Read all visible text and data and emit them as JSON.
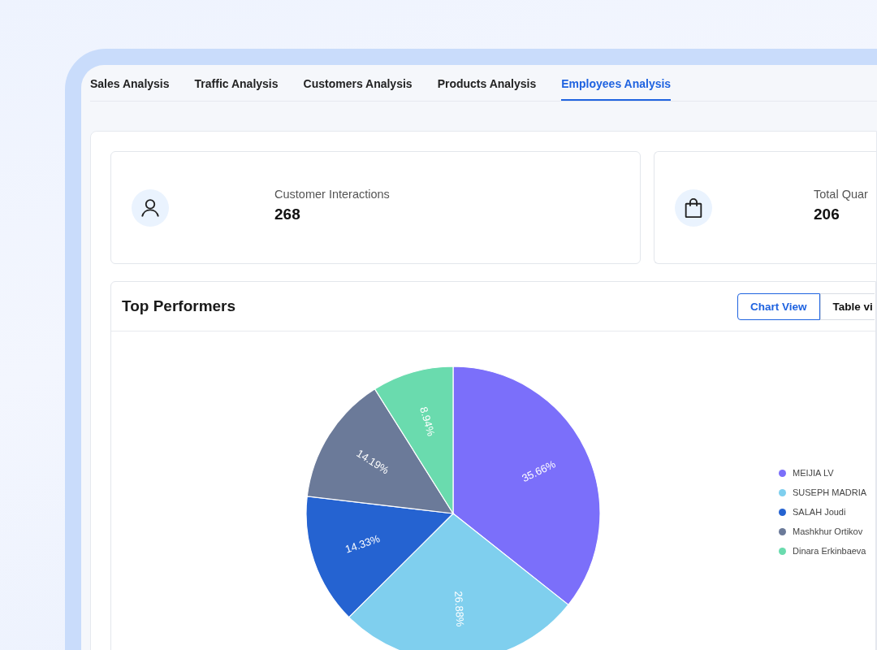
{
  "tabs": [
    {
      "label": "Sales Analysis",
      "selected": false
    },
    {
      "label": "Traffic Analysis",
      "selected": false
    },
    {
      "label": "Customers Analysis",
      "selected": false
    },
    {
      "label": "Products Analysis",
      "selected": false
    },
    {
      "label": "Employees Analysis",
      "selected": true
    }
  ],
  "stats": [
    {
      "kind": "person",
      "label": "Customer Interactions",
      "value": "268"
    },
    {
      "kind": "bag",
      "label": "Total Quar",
      "value": "206"
    }
  ],
  "top_performers": {
    "title": "Top Performers",
    "view_toggle": [
      {
        "label": "Chart View",
        "selected": true
      },
      {
        "label": "Table vi",
        "selected": false
      }
    ],
    "chart_data": {
      "type": "pie",
      "categories": [
        "MEIJIA LV",
        "SUSEPH MADRIA",
        "SALAH Joudi",
        "Mashkhur Ortikov",
        "Dinara Erkinbaeva"
      ],
      "values": [
        35.66,
        26.88,
        14.33,
        14.19,
        8.94
      ],
      "colors": [
        "#7b6ffa",
        "#7fcfee",
        "#2563d1",
        "#6b7a99",
        "#6adbae"
      ],
      "value_labels": [
        "35.66%",
        "26.88%",
        "14.33%",
        "14.19%",
        "8.94%"
      ]
    }
  }
}
